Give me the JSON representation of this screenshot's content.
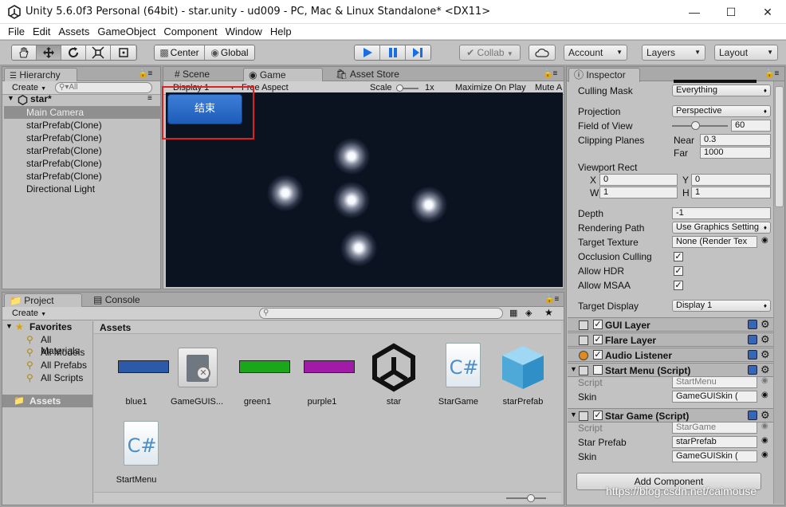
{
  "window": {
    "title": "Unity 5.6.0f3 Personal (64bit) - star.unity - ud009 - PC, Mac & Linux Standalone* <DX11>"
  },
  "menu": [
    "File",
    "Edit",
    "Assets",
    "GameObject",
    "Component",
    "Window",
    "Help"
  ],
  "toolbar": {
    "center": "Center",
    "global": "Global",
    "collab": "Collab",
    "account": "Account",
    "layers": "Layers",
    "layout": "Layout"
  },
  "hierarchy": {
    "tab": "Hierarchy",
    "create": "Create",
    "search": "All",
    "scene": "star*",
    "items": [
      "Main Camera",
      "starPrefab(Clone)",
      "starPrefab(Clone)",
      "starPrefab(Clone)",
      "starPrefab(Clone)",
      "starPrefab(Clone)",
      "Directional Light"
    ]
  },
  "tabs": {
    "scene": "Scene",
    "game": "Game",
    "asset_store": "Asset Store"
  },
  "game": {
    "display": "Display 1",
    "aspect": "Free Aspect",
    "scale_label": "Scale",
    "scale_value": "1x",
    "maximize": "Maximize On Play",
    "mute": "Mute A",
    "button": "结束"
  },
  "project": {
    "tab": "Project",
    "console_tab": "Console",
    "create": "Create",
    "favorites": "Favorites",
    "fav_items": [
      "All Materials",
      "All Models",
      "All Prefabs",
      "All Scripts"
    ],
    "assets_root": "Assets",
    "breadcrumb": "Assets",
    "assets": [
      {
        "name": "blue1",
        "kind": "bar",
        "color": "#2a5aa8"
      },
      {
        "name": "GameGUIS...",
        "kind": "guiskin"
      },
      {
        "name": "green1",
        "kind": "bar",
        "color": "#1aa81a"
      },
      {
        "name": "purple1",
        "kind": "bar",
        "color": "#a21aa8"
      },
      {
        "name": "star",
        "kind": "unity"
      },
      {
        "name": "StarGame",
        "kind": "script"
      },
      {
        "name": "starPrefab",
        "kind": "prefab"
      },
      {
        "name": "StartMenu",
        "kind": "script"
      }
    ]
  },
  "inspector": {
    "tab": "Inspector",
    "culling_mask_label": "Culling Mask",
    "culling_mask": "Everything",
    "projection_label": "Projection",
    "projection": "Perspective",
    "fov_label": "Field of View",
    "fov": "60",
    "fov_slider": 0.42,
    "clipping_label": "Clipping Planes",
    "near_label": "Near",
    "near": "0.3",
    "far_label": "Far",
    "far": "1000",
    "viewport_label": "Viewport Rect",
    "x_label": "X",
    "x": "0",
    "y_label": "Y",
    "y": "0",
    "w_label": "W",
    "w": "1",
    "h_label": "H",
    "h": "1",
    "depth_label": "Depth",
    "depth": "-1",
    "rendering_label": "Rendering Path",
    "rendering": "Use Graphics Setting",
    "target_tex_label": "Target Texture",
    "target_tex": "None (Render Tex",
    "occlusion_label": "Occlusion Culling",
    "hdr_label": "Allow HDR",
    "msaa_label": "Allow MSAA",
    "target_display_label": "Target Display",
    "target_display": "Display 1",
    "components": {
      "gui_layer": "GUI Layer",
      "flare_layer": "Flare Layer",
      "audio_listener": "Audio Listener",
      "start_menu": "Start Menu (Script)",
      "star_game": "Star Game (Script)"
    },
    "script_label": "Script",
    "skin_label": "Skin",
    "star_prefab_label": "Star Prefab",
    "start_menu_script": "StartMenu",
    "start_menu_skin": "GameGUISkin (",
    "star_game_script": "StarGame",
    "star_game_prefab": "starPrefab",
    "star_game_skin": "GameGUISkin (",
    "add_component": "Add Component"
  },
  "watermark": "https://blog.csdn.net/caimouse"
}
